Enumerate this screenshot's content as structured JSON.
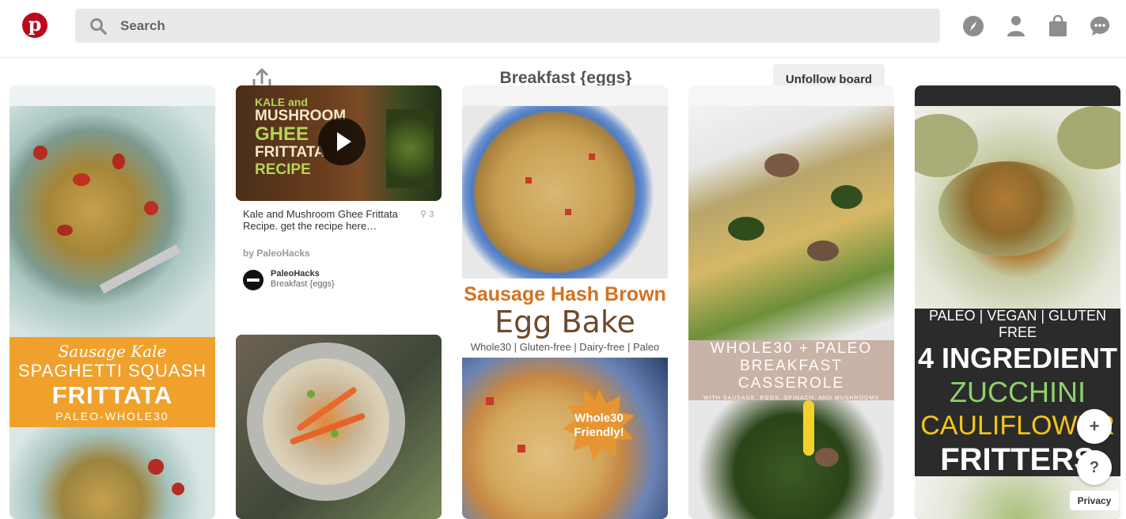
{
  "header": {
    "logo_letter": "p",
    "search_placeholder": "Search",
    "icons": [
      "compass-icon",
      "profile-icon",
      "shopping-bag-icon",
      "messages-icon"
    ]
  },
  "board": {
    "title": "Breakfast {eggs}",
    "unfollow_label": "Unfollow board"
  },
  "pins": {
    "p1": {
      "line1": "Sausage Kale",
      "line2": "SPAGHETTI SQUASH",
      "line3": "FRITTATA",
      "line4": "PALEO-WHOLE30"
    },
    "p2": {
      "overlay": [
        "KALE and",
        "MUSHROOM",
        "GHEE",
        "FRITTATA",
        "RECIPE"
      ],
      "description": "Kale and Mushroom Ghee Frittata Recipe. get the recipe here…",
      "repins": "3",
      "source": "by PaleoHacks",
      "pinner_name": "PaleoHacks",
      "pinner_board": "Breakfast {eggs}"
    },
    "p4": {
      "line1": "Sausage Hash Brown",
      "line2": "Egg Bake",
      "line3": "Whole30 | Gluten-free | Dairy-free | Paleo",
      "badge1": "Whole30",
      "badge2": "Friendly!"
    },
    "p5": {
      "line1": "WHOLE30 + PALEO",
      "line2": "BREAKFAST CASSEROLE",
      "line3": "WITH SAUSAGE, EGGS, SPINACH, AND MUSHROOMS"
    },
    "p6": {
      "line1": "PALEO | VEGAN | GLUTEN FREE",
      "line2": "4 INGREDIENT",
      "line3": "ZUCCHINI",
      "line4": "CAULIFLOWER",
      "line5": "FRITTERS"
    }
  },
  "fab": {
    "add": "+",
    "help": "?"
  },
  "privacy_label": "Privacy",
  "colors": {
    "brand": "#bd081c",
    "orange_band": "#f0a12c",
    "taupe_band": "#c9b2a6",
    "dark_band": "#2b2b2b",
    "green_text": "#8fd16a",
    "yellow_text": "#f5c518"
  }
}
